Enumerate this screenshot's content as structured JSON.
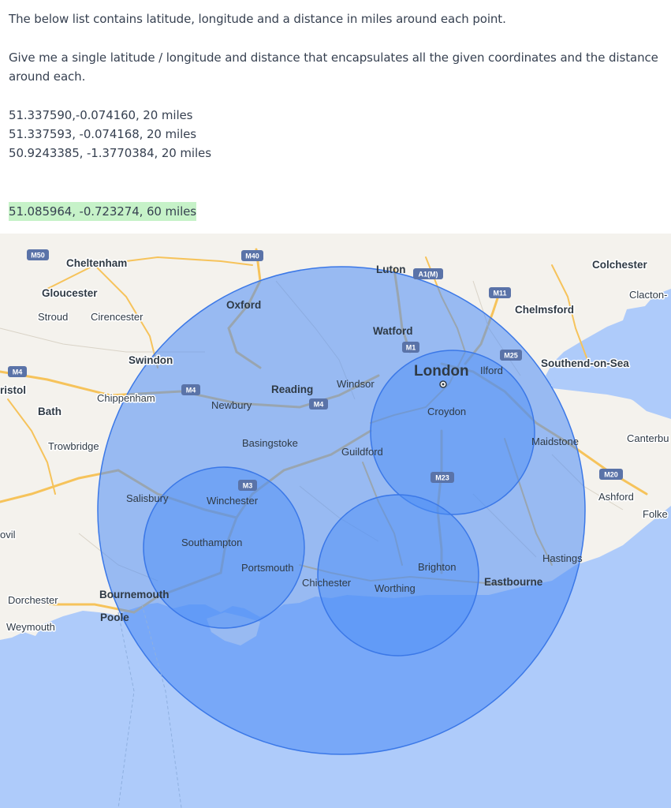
{
  "chat": {
    "line1": "The below list contains latitude, longitude and a distance in miles around each point.",
    "line2a": "Give me a single latitude / longitude and distance that encapsulates all the given coordinates and the distance",
    "line2b": "around each.",
    "coords": [
      "51.337590,-0.074160, 20 miles",
      "51.337593, -0.074168, 20 miles",
      "50.9243385, -1.3770384, 20 miles"
    ],
    "answer": "51.085964, -0.723274, 60 miles"
  },
  "map": {
    "colors": {
      "land": "#f4f2ed",
      "sea": "#aecbfa",
      "circle_fill": "#4c8df5",
      "circle_stroke": "#3b78e7",
      "motorway": "#f6c35b",
      "shield": "#5a73a8"
    },
    "places": [
      {
        "name": "Cheltenham",
        "size": "med"
      },
      {
        "name": "Gloucester",
        "size": "med"
      },
      {
        "name": "Stroud",
        "size": "sml"
      },
      {
        "name": "Cirencester",
        "size": "sml"
      },
      {
        "name": "Swindon",
        "size": "med"
      },
      {
        "name": "ristol",
        "size": "med"
      },
      {
        "name": "Chippenham",
        "size": "sml"
      },
      {
        "name": "Bath",
        "size": "med"
      },
      {
        "name": "Trowbridge",
        "size": "sml"
      },
      {
        "name": "Salisbury",
        "size": "sml"
      },
      {
        "name": "ovil",
        "size": "sml"
      },
      {
        "name": "Dorchester",
        "size": "sml"
      },
      {
        "name": "Weymouth",
        "size": "sml"
      },
      {
        "name": "Bournemouth",
        "size": "med"
      },
      {
        "name": "Poole",
        "size": "med"
      },
      {
        "name": "Oxford",
        "size": "med"
      },
      {
        "name": "Luton",
        "size": "med"
      },
      {
        "name": "Watford",
        "size": "med"
      },
      {
        "name": "Reading",
        "size": "med"
      },
      {
        "name": "Windsor",
        "size": "sml"
      },
      {
        "name": "Newbury",
        "size": "sml"
      },
      {
        "name": "Basingstoke",
        "size": "sml"
      },
      {
        "name": "Guildford",
        "size": "sml"
      },
      {
        "name": "Winchester",
        "size": "sml"
      },
      {
        "name": "Southampton",
        "size": "sml"
      },
      {
        "name": "Portsmouth",
        "size": "sml"
      },
      {
        "name": "Chichester",
        "size": "sml"
      },
      {
        "name": "Worthing",
        "size": "sml"
      },
      {
        "name": "Brighton",
        "size": "sml"
      },
      {
        "name": "London",
        "size": "big"
      },
      {
        "name": "Ilford",
        "size": "sml"
      },
      {
        "name": "Croydon",
        "size": "sml"
      },
      {
        "name": "Colchester",
        "size": "med"
      },
      {
        "name": "Clacton-",
        "size": "sml"
      },
      {
        "name": "Chelmsford",
        "size": "med"
      },
      {
        "name": "Southend-on-Sea",
        "size": "med"
      },
      {
        "name": "Maidstone",
        "size": "sml"
      },
      {
        "name": "Canterbu",
        "size": "sml"
      },
      {
        "name": "Ashford",
        "size": "sml"
      },
      {
        "name": "Folke",
        "size": "sml"
      },
      {
        "name": "Hastings",
        "size": "sml"
      },
      {
        "name": "Eastbourne",
        "size": "med"
      }
    ],
    "shields": [
      "M50",
      "M40",
      "A1(M)",
      "M11",
      "M1",
      "M25",
      "M4",
      "M4",
      "M4",
      "M3",
      "M23",
      "M20"
    ]
  }
}
